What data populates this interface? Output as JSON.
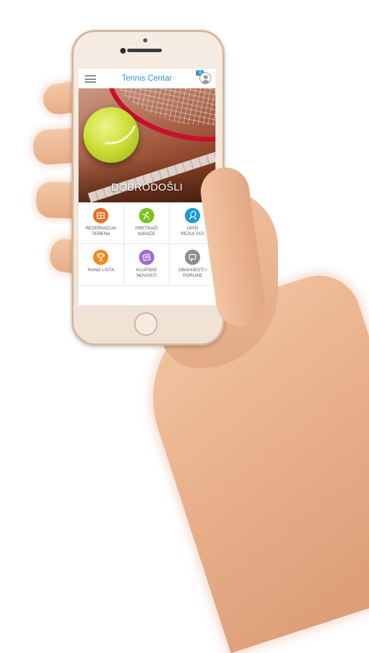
{
  "app": {
    "title": "Tennis Centar",
    "notification_badge": "16"
  },
  "hero": {
    "title": "DOBRODOŠLI"
  },
  "tiles": [
    {
      "label": "REZERVACIJA\nTERENA",
      "icon": "court-icon",
      "color": "#e8701e"
    },
    {
      "label": "PRETRAŽI\nIGRAČE",
      "icon": "player-icon",
      "color": "#7cc21f"
    },
    {
      "label": "UPIŠI\nREZULTATI",
      "icon": "racket-ball-icon",
      "color": "#1c9ad6"
    },
    {
      "label": "RANG LISTA",
      "icon": "trophy-icon",
      "color": "#f08a1c"
    },
    {
      "label": "KLUPSKE\nNOVOSTI",
      "icon": "newspaper-icon",
      "color": "#9b6fd0"
    },
    {
      "label": "OBAVIJESTI I\nPORUKE",
      "icon": "chat-icon",
      "color": "#8e8e8e"
    }
  ]
}
